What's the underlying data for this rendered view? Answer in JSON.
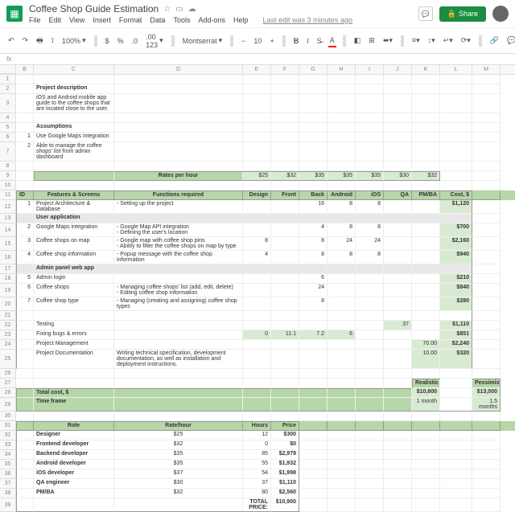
{
  "doc": {
    "title": "Coffee Shop Guide Estimation",
    "last_edit": "Last edit was 3 minutes ago"
  },
  "menus": [
    "File",
    "Edit",
    "View",
    "Insert",
    "Format",
    "Data",
    "Tools",
    "Add-ons",
    "Help"
  ],
  "share": "Share",
  "toolbar": {
    "zoom": "100%",
    "font": "Montserrat",
    "size": "10",
    "fmt": ".00 123"
  },
  "cols": [
    "",
    "B",
    "C",
    "D",
    "E",
    "F",
    "G",
    "H",
    "I",
    "J",
    "K",
    "L",
    "M"
  ],
  "proj_desc": {
    "h": "Project description",
    "txt": "iOS and Android mobile app guide to the coffee shops that are located close to the user."
  },
  "assump": {
    "h": "Assumptions",
    "r1": "1",
    "t1": "Use Google Maps integration",
    "r2": "2",
    "t2": "Able to manage the coffee shops' list from admin dashboard"
  },
  "rates": {
    "label": "Rates per hour",
    "v": [
      "$25",
      "$32",
      "$35",
      "$35",
      "$35",
      "$30",
      "$32"
    ]
  },
  "thdr": {
    "id": "ID",
    "fs": "Features & Screens",
    "fn": "Functions required",
    "des": "Design",
    "fr": "Front",
    "bk": "Back",
    "an": "Android",
    "ios": "iOS",
    "qa": "QA",
    "pm": "PM/BA",
    "cost": "Cost, $"
  },
  "rows": [
    {
      "id": "1",
      "fs": "Project Architecture & Database",
      "fn": "- Setting up the project",
      "v": [
        "",
        "",
        "16",
        "8",
        "8",
        "",
        ""
      ],
      "cost": "$1,120"
    },
    {
      "sec": "User application"
    },
    {
      "id": "2",
      "fs": "Google Maps integration",
      "fn": "- Google Map API integration\n- Defining the user's location",
      "v": [
        "",
        "",
        "4",
        "8",
        "8",
        "",
        ""
      ],
      "cost": "$700"
    },
    {
      "id": "3",
      "fs": "Coffee shops on map",
      "fn": "- Google map with coffee shop pins\n- Ability to filter the coffee shops on map by type",
      "v": [
        "8",
        "",
        "8",
        "24",
        "24",
        "",
        ""
      ],
      "cost": "$2,160"
    },
    {
      "id": "4",
      "fs": "Coffee shop information",
      "fn": "- Popup message with the coffee shop information",
      "v": [
        "4",
        "",
        "8",
        "8",
        "8",
        "",
        ""
      ],
      "cost": "$940"
    },
    {
      "sec": "Admin panel web app"
    },
    {
      "id": "5",
      "fs": "Admin login",
      "fn": "",
      "v": [
        "",
        "",
        "6",
        "",
        "",
        "",
        ""
      ],
      "cost": "$210"
    },
    {
      "id": "6",
      "fs": "Coffee shops",
      "fn": "- Managing coffee shops' list (add, edit, delete)\n- Editing coffee shop information",
      "v": [
        "",
        "",
        "24",
        "",
        "",
        "",
        ""
      ],
      "cost": "$840"
    },
    {
      "id": "7",
      "fs": "Coffee shop type",
      "fn": "- Managing (creating and assigning) coffee shop types",
      "v": [
        "",
        "",
        "8",
        "",
        "",
        "",
        ""
      ],
      "cost": "$280"
    }
  ],
  "btm": [
    {
      "fs": "Testing",
      "v": [
        "",
        "",
        "",
        "",
        "",
        "37",
        ""
      ],
      "cost": "$1,110"
    },
    {
      "fs": "Fixing bugs & errors",
      "v": [
        "0",
        "11.1",
        "7.2",
        "6",
        "",
        "",
        ""
      ],
      "cost": "$851",
      "grn": true
    },
    {
      "fs": "Project Management",
      "v": [
        "",
        "",
        "",
        "",
        "",
        "",
        "70.00"
      ],
      "cost": "$2,240",
      "kgrn": true
    },
    {
      "fs": "Project Documentation",
      "fn": "Writing technical specification, development documentation, as well as installation and deployment instructions.",
      "v": [
        "",
        "",
        "",
        "",
        "",
        "",
        "10.00"
      ],
      "cost": "$320",
      "kgrn": true
    }
  ],
  "summary": {
    "real": "Realistic",
    "pess": "Pessimistic",
    "tc": "Total cost, $",
    "tcv": [
      "$10,800",
      "$13,000"
    ],
    "tf": "Time frame",
    "tfv": [
      "1 month",
      "1.5 months"
    ]
  },
  "roles": {
    "h": [
      "Role",
      "Rate/hour",
      "Hours",
      "Price"
    ],
    "rows": [
      [
        "Designer",
        "$25",
        "12",
        "$300"
      ],
      [
        "Frontend developer",
        "$32",
        "0",
        "$0"
      ],
      [
        "Backend developer",
        "$35",
        "85",
        "$2,979"
      ],
      [
        "Android developer",
        "$35",
        "55",
        "$1,932"
      ],
      [
        "iOS developer",
        "$37",
        "54",
        "$1,998"
      ],
      [
        "QA engineer",
        "$30",
        "37",
        "$1,110"
      ],
      [
        "PM/BA",
        "$32",
        "80",
        "$2,560"
      ]
    ],
    "total": "TOTAL PRICE:",
    "totalv": "$10,900"
  }
}
